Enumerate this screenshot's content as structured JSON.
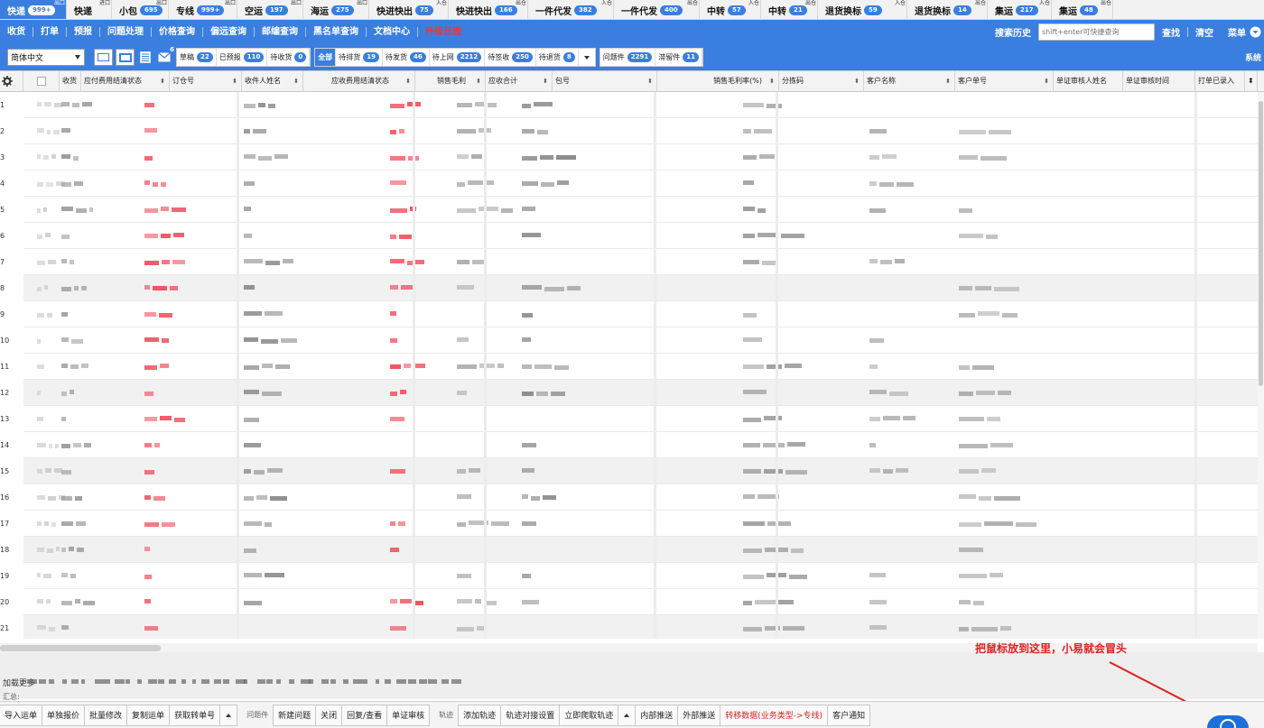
{
  "top_tabs": [
    {
      "label": "快递",
      "badge": "999+",
      "tag": "出口",
      "active": true
    },
    {
      "label": "快递",
      "badge": "",
      "tag": "进口",
      "active": false
    },
    {
      "label": "小包",
      "badge": "695",
      "tag": "出口",
      "active": false
    },
    {
      "label": "专线",
      "badge": "999+",
      "tag": "出口",
      "active": false
    },
    {
      "label": "空运",
      "badge": "197",
      "tag": "出口",
      "active": false
    },
    {
      "label": "海运",
      "badge": "275",
      "tag": "出口",
      "active": false
    },
    {
      "label": "快进快出",
      "badge": "75",
      "tag": "入仓",
      "active": false
    },
    {
      "label": "快进快出",
      "badge": "166",
      "tag": "出仓",
      "active": false
    },
    {
      "label": "一件代发",
      "badge": "382",
      "tag": "入仓",
      "active": false
    },
    {
      "label": "一件代发",
      "badge": "400",
      "tag": "出仓",
      "active": false
    },
    {
      "label": "中转",
      "badge": "57",
      "tag": "入仓",
      "active": false
    },
    {
      "label": "中转",
      "badge": "21",
      "tag": "出仓",
      "active": false
    },
    {
      "label": "退货换标",
      "badge": "59",
      "tag": "入仓",
      "active": false
    },
    {
      "label": "退货换标",
      "badge": "14",
      "tag": "出仓",
      "active": false
    },
    {
      "label": "集运",
      "badge": "217",
      "tag": "入仓",
      "active": false
    },
    {
      "label": "集运",
      "badge": "48",
      "tag": "出仓",
      "active": false
    }
  ],
  "nav": {
    "items": [
      "收货",
      "打单",
      "预报",
      "问题处理",
      "价格查询",
      "偏远查询",
      "邮编查询",
      "黑名单查询",
      "文档中心",
      "升级日志"
    ],
    "search_history": "搜索历史",
    "quick_placeholder": "shift+enter可快捷查询",
    "find": "查找",
    "clear": "清空",
    "menu": "菜单"
  },
  "filter": {
    "language": "简体中文",
    "mail_count": "6",
    "status_group": [
      {
        "label": "草稿",
        "badge": "22",
        "active": false
      },
      {
        "label": "已预报",
        "badge": "110",
        "active": false
      },
      {
        "label": "待收货",
        "badge": "0",
        "active": false
      }
    ],
    "flow_group": [
      {
        "label": "全部",
        "badge": "",
        "active": true
      },
      {
        "label": "待排货",
        "badge": "19",
        "active": false
      },
      {
        "label": "待发货",
        "badge": "46",
        "active": false
      },
      {
        "label": "待上网",
        "badge": "2212",
        "active": false
      },
      {
        "label": "待签收",
        "badge": "250",
        "active": false
      },
      {
        "label": "待退货",
        "badge": "8",
        "active": false
      }
    ],
    "issue_group": [
      {
        "label": "问题件",
        "badge": "2291",
        "active": false
      },
      {
        "label": "滞留件",
        "badge": "11",
        "active": false
      }
    ],
    "system": "系统"
  },
  "columns": [
    "收货",
    "应付费用结清状态",
    "订仓号",
    "收件人姓名",
    "应收费用结清状态",
    "销售毛利",
    "应收合计",
    "包号",
    "销售毛利率(%)",
    "分拣码",
    "客户名称",
    "客户单号",
    "单证审核人姓名",
    "单证审核时间",
    "打单已录入"
  ],
  "row_numbers": [
    "1",
    "2",
    "3",
    "4",
    "5",
    "6",
    "7",
    "8",
    "9",
    "10",
    "11",
    "12",
    "13",
    "14",
    "15",
    "16",
    "17",
    "18",
    "19",
    "20",
    "21"
  ],
  "footer": {
    "load": "加载更多",
    "summary": "汇总:"
  },
  "hint": "把鼠标放到这里，小易就会冒头",
  "bottom": {
    "group1": [
      "导入运单",
      "单独报价",
      "批量修改",
      "复制运单",
      "获取转单号"
    ],
    "label_issue": "问题件",
    "group2": [
      "新建问题",
      "关闭",
      "回复/查看",
      "单证审核"
    ],
    "label_track": "轨迹",
    "group3": [
      "添加轨迹",
      "轨迹对接设置",
      "立即爬取轨迹"
    ],
    "group4": [
      "内部推送",
      "外部推送",
      "转移数据(业务类型->专线)",
      "客户通知"
    ]
  },
  "colors": {
    "accent": "#3a7fe0",
    "alert": "#e02020",
    "redacted_red": "#f04a5a"
  }
}
